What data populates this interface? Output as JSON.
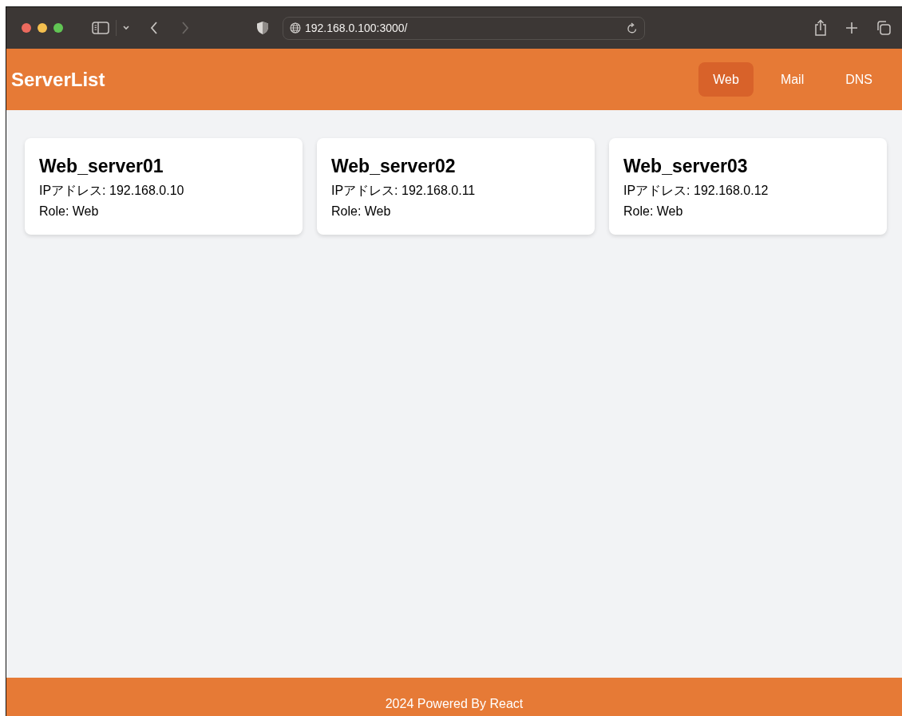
{
  "browser": {
    "url": "192.168.0.100:3000/"
  },
  "header": {
    "title": "ServerList",
    "nav": [
      {
        "label": "Web",
        "selected": true
      },
      {
        "label": "Mail",
        "selected": false
      },
      {
        "label": "DNS",
        "selected": false
      }
    ]
  },
  "servers": [
    {
      "name": "Web_server01",
      "ip": "IPアドレス: 192.168.0.10",
      "role": "Role: Web"
    },
    {
      "name": "Web_server02",
      "ip": "IPアドレス: 192.168.0.11",
      "role": "Role: Web"
    },
    {
      "name": "Web_server03",
      "ip": "IPアドレス: 192.168.0.12",
      "role": "Role: Web"
    }
  ],
  "footer": {
    "text": "2024 Powered By React"
  }
}
